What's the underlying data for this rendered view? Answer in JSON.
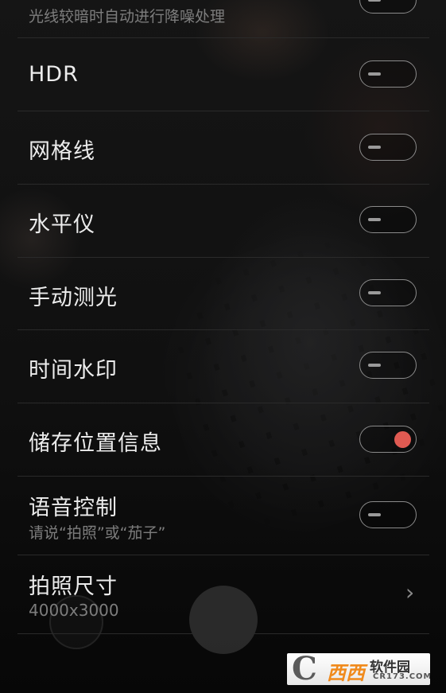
{
  "settings": {
    "noise": {
      "subtitle": "光线较暗时自动进行降噪处理",
      "enabled": false
    },
    "hdr": {
      "title": "HDR",
      "enabled": false
    },
    "grid": {
      "title": "网格线",
      "enabled": false
    },
    "level": {
      "title": "水平仪",
      "enabled": false
    },
    "metering": {
      "title": "手动测光",
      "enabled": false
    },
    "timestamp": {
      "title": "时间水印",
      "enabled": false
    },
    "location": {
      "title": "储存位置信息",
      "enabled": true
    },
    "voice": {
      "title": "语音控制",
      "subtitle": "请说“拍照”或“茄子”",
      "enabled": false
    },
    "photo_size": {
      "title": "拍照尺寸",
      "value": "4000x3000",
      "chevron": "›"
    }
  },
  "colors": {
    "toggle_on": "#e05a52",
    "toggle_border": "#8a8a8a",
    "divider": "#2a2a2a"
  },
  "watermark": {
    "logo_letter": "C",
    "brand": "西西",
    "name": "软件园",
    "url": "CR173.COM"
  }
}
